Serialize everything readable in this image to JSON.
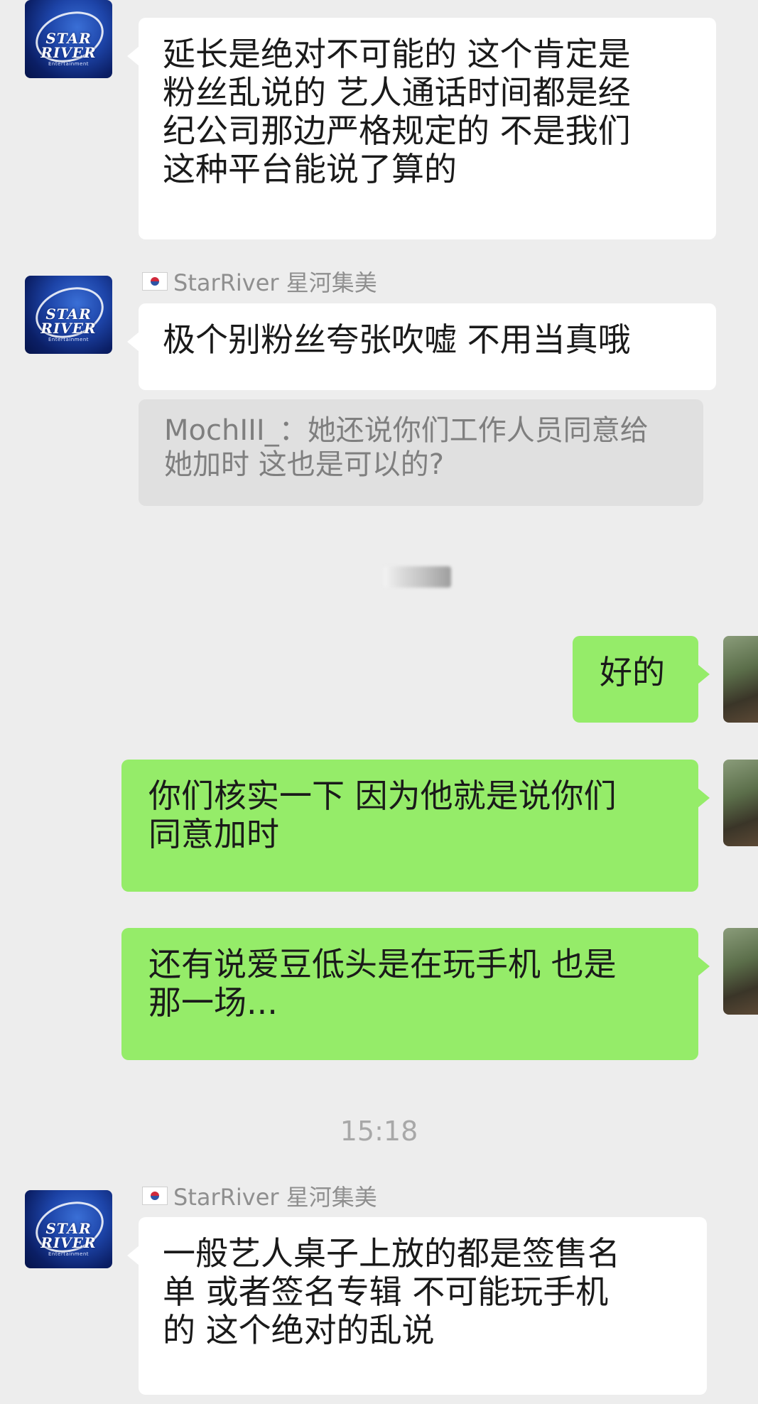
{
  "messages": [
    {
      "sender": "",
      "text": "延长是绝对不可能的 这个肯定是\n粉丝乱说的 艺人通话时间都是经\n纪公司那边严格规定的 不是我们\n这种平台能说了算的"
    },
    {
      "sender": "StarRiver 星河集美",
      "text": "极个别粉丝夸张吹嘘 不用当真哦",
      "quote": "MochIII_：她还说你们工作人员同意给\n她加时 这也是可以的?"
    },
    {
      "text": "好的"
    },
    {
      "text": "你们核实一下 因为他就是说你们\n同意加时"
    },
    {
      "text": "还有说爱豆低头是在玩手机 也是\n那一场..."
    },
    {
      "sender": "StarRiver 星河集美",
      "text": "一般艺人桌子上放的都是签售名\n单 或者签名专辑 不可能玩手机\n的 这个绝对的乱说"
    }
  ],
  "timestamp": "15:18",
  "avatar_brand": "STAR RIVER",
  "avatar_brand_sub": "Entertainment",
  "flag_icon": "south-korea-flag-icon",
  "colors": {
    "background": "#ededed",
    "incoming_bubble": "#ffffff",
    "outgoing_bubble": "#95ec69",
    "quote_bg": "#e0e0e0",
    "timestamp": "#a8a8a8"
  }
}
